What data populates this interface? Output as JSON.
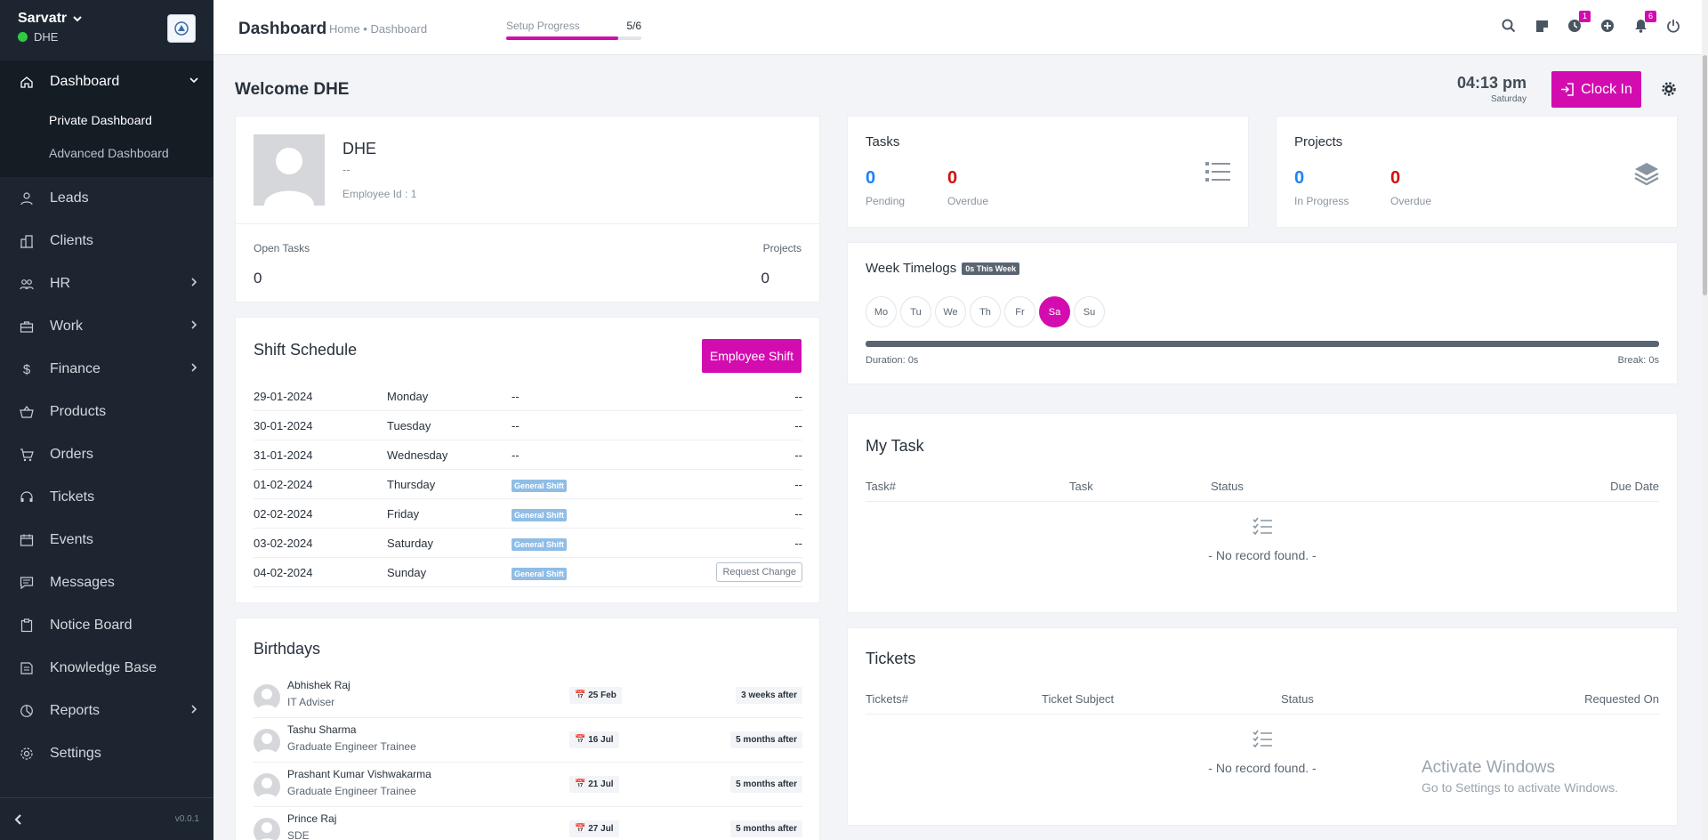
{
  "sidebar": {
    "company": "Sarvatr",
    "user": "DHE",
    "items": [
      {
        "label": "Dashboard",
        "icon": "home-icon"
      },
      {
        "label": "Private Dashboard"
      },
      {
        "label": "Advanced Dashboard"
      },
      {
        "label": "Leads",
        "icon": "user-icon"
      },
      {
        "label": "Clients",
        "icon": "building-icon"
      },
      {
        "label": "HR",
        "icon": "people-icon"
      },
      {
        "label": "Work",
        "icon": "briefcase-icon"
      },
      {
        "label": "Finance",
        "icon": "dollar-icon"
      },
      {
        "label": "Products",
        "icon": "basket-icon"
      },
      {
        "label": "Orders",
        "icon": "cart-icon"
      },
      {
        "label": "Tickets",
        "icon": "headset-icon"
      },
      {
        "label": "Events",
        "icon": "calendar-icon"
      },
      {
        "label": "Messages",
        "icon": "chat-icon"
      },
      {
        "label": "Notice Board",
        "icon": "clipboard-icon"
      },
      {
        "label": "Knowledge Base",
        "icon": "book-icon"
      },
      {
        "label": "Reports",
        "icon": "pie-chart-icon"
      },
      {
        "label": "Settings",
        "icon": "gear-icon"
      }
    ],
    "version": "v0.0.1"
  },
  "header": {
    "title": "Dashboard",
    "breadcrumb": "Home • Dashboard",
    "setup_label": "Setup Progress",
    "setup_count": "5/6",
    "setup_progress": 0.83,
    "notification_badges": {
      "timer": "1",
      "bell": "6"
    }
  },
  "welcome": "Welcome DHE",
  "clock": {
    "time": "04:13 pm",
    "day": "Saturday",
    "button": "Clock In"
  },
  "profile": {
    "name": "DHE",
    "designation": "--",
    "employee_id": "Employee Id : 1",
    "open_tasks_label": "Open Tasks",
    "open_tasks": "0",
    "projects_label": "Projects",
    "projects": "0"
  },
  "shift": {
    "title": "Shift Schedule",
    "button": "Employee Shift",
    "rows": [
      {
        "date": "29-01-2024",
        "day": "Monday",
        "shift": "--",
        "action": "--"
      },
      {
        "date": "30-01-2024",
        "day": "Tuesday",
        "shift": "--",
        "action": "--"
      },
      {
        "date": "31-01-2024",
        "day": "Wednesday",
        "shift": "--",
        "action": "--"
      },
      {
        "date": "01-02-2024",
        "day": "Thursday",
        "shift": "General Shift",
        "action": "--"
      },
      {
        "date": "02-02-2024",
        "day": "Friday",
        "shift": "General Shift",
        "action": "--"
      },
      {
        "date": "03-02-2024",
        "day": "Saturday",
        "shift": "General Shift",
        "action": "--"
      },
      {
        "date": "04-02-2024",
        "day": "Sunday",
        "shift": "General Shift",
        "action": "Request Change"
      }
    ]
  },
  "birthdays": {
    "title": "Birthdays",
    "rows": [
      {
        "name": "Abhishek Raj",
        "role": "IT Adviser",
        "date": "25 Feb",
        "when": "3 weeks after"
      },
      {
        "name": "Tashu Sharma",
        "role": "Graduate Engineer Trainee",
        "date": "16 Jul",
        "when": "5 months after"
      },
      {
        "name": "Prashant Kumar Vishwakarma",
        "role": "Graduate Engineer Trainee",
        "date": "21 Jul",
        "when": "5 months after"
      },
      {
        "name": "Prince Raj",
        "role": "SDE",
        "date": "27 Jul",
        "when": "5 months after"
      }
    ]
  },
  "tasks": {
    "title": "Tasks",
    "pending": "0",
    "pending_label": "Pending",
    "overdue": "0",
    "overdue_label": "Overdue"
  },
  "projects": {
    "title": "Projects",
    "in_progress": "0",
    "in_progress_label": "In Progress",
    "overdue": "0",
    "overdue_label": "Overdue"
  },
  "timelogs": {
    "title": "Week Timelogs",
    "badge": "0s This Week",
    "days": [
      "Mo",
      "Tu",
      "We",
      "Th",
      "Fr",
      "Sa",
      "Su"
    ],
    "active_day": "Sa",
    "duration": "Duration: 0s",
    "break": "Break: 0s"
  },
  "my_task": {
    "title": "My Task",
    "columns": [
      "Task#",
      "Task",
      "Status",
      "Due Date"
    ],
    "empty": "- No record found. -"
  },
  "tickets": {
    "title": "Tickets",
    "columns": [
      "Tickets#",
      "Ticket Subject",
      "Status",
      "Requested On"
    ],
    "empty": "- No record found. -"
  },
  "watermark": {
    "line1": "Activate Windows",
    "line2": "Go to Settings to activate Windows."
  },
  "colors": {
    "accent": "#d30caf",
    "sidebar": "#1d2630",
    "blue": "#1d82f5",
    "red": "#d21010"
  }
}
